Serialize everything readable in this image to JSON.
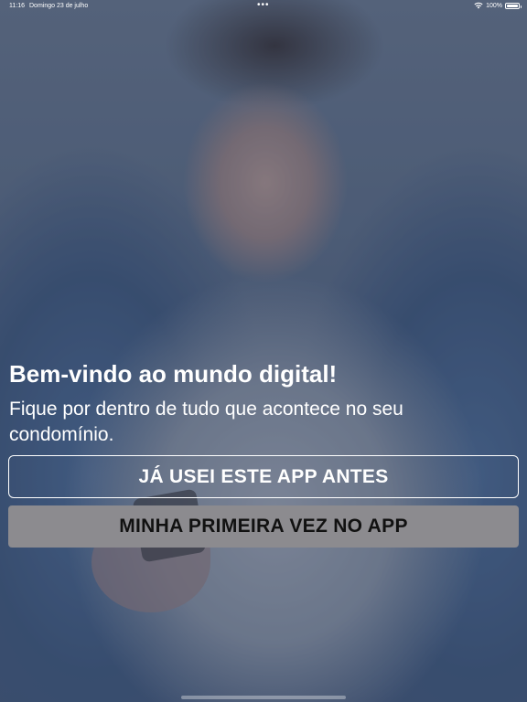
{
  "status_bar": {
    "time": "11:16",
    "date": "Domingo 23 de julho",
    "multitask_dots": "•••",
    "battery": "100%"
  },
  "welcome": {
    "title": "Bem-vindo ao mundo digital!",
    "subtitle": "Fique por dentro de tudo que acontece no seu condomínio."
  },
  "buttons": {
    "existing_user": "JÁ USEI ESTE APP ANTES",
    "first_time": "MINHA PRIMEIRA VEZ NO APP"
  },
  "icons": {
    "wifi": "wifi-icon",
    "battery": "battery-icon"
  },
  "colors": {
    "overlay": "#2a3a58",
    "first_button_bg": "#8c8b8f",
    "text": "#ffffff"
  }
}
